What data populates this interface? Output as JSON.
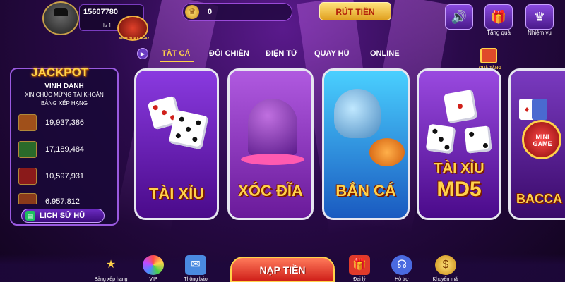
{
  "header": {
    "user_id": "15607780",
    "level": "lv.1",
    "level_badge_text": "KÍCH HOẠT NGAY",
    "coin_balance": "0",
    "withdraw_label": "RÚT TIỀN",
    "sound_icon": "speaker-icon",
    "gift_label": "Tặng quà",
    "mission_label": "Nhiệm vụ"
  },
  "tabs": [
    {
      "label": "TẤT CẢ",
      "active": true
    },
    {
      "label": "ĐỐI CHIẾN",
      "active": false
    },
    {
      "label": "ĐIỆN TỬ",
      "active": false
    },
    {
      "label": "QUAY HŨ",
      "active": false
    },
    {
      "label": "ONLINE",
      "active": false
    }
  ],
  "gift_badge_label": "QUÀ TẶNG",
  "jackpot": {
    "title": "JACKPOT",
    "vinh_danh": "VINH DANH",
    "congrats": "XIN CHÚC MỪNG TÀI KHOẢN",
    "ranking": "BẢNG XẾP HẠNG",
    "entries": [
      {
        "value": "19,937,386",
        "thumb_color": "#a0501a"
      },
      {
        "value": "17,189,484",
        "thumb_color": "#2a6a2a"
      },
      {
        "value": "10,597,931",
        "thumb_color": "#8a1a1a"
      },
      {
        "value": "6,957,812",
        "thumb_color": "#8a3a1a"
      }
    ],
    "history_label": "LỊCH SỬ HŨ"
  },
  "games": [
    {
      "title": "TÀI XỈU"
    },
    {
      "title": "XÓC ĐĨA"
    },
    {
      "title": "BẮN CÁ"
    },
    {
      "title_line1": "TÀI XỈU",
      "title_line2": "MD5"
    },
    {
      "title": "BACCA",
      "badge": "MINI GAME"
    }
  ],
  "bottom": {
    "ranking_label": "Bảng xếp hạng",
    "vip_label": "VIP",
    "notify_label": "Thông báo",
    "deposit_label": "NẠP TIỀN",
    "agent_label": "Đại lý",
    "support_label": "Hỗ trợ",
    "promo_label": "Khuyến mãi"
  },
  "colors": {
    "accent": "#ffd24a",
    "background": "#2a0a4a",
    "deposit": "#d0201a"
  }
}
